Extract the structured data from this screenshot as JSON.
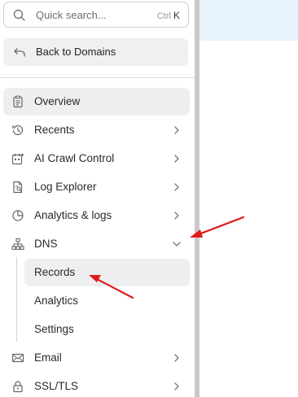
{
  "search": {
    "placeholder": "Quick search...",
    "shortcut_ctrl": "Ctrl",
    "shortcut_key": "K"
  },
  "back": {
    "label": "Back to Domains"
  },
  "nav": {
    "overview": "Overview",
    "recents": "Recents",
    "ai_crawl": "AI Crawl Control",
    "log_explorer": "Log Explorer",
    "analytics_logs": "Analytics & logs",
    "dns": "DNS",
    "email": "Email",
    "ssl": "SSL/TLS"
  },
  "dns_sub": {
    "records": "Records",
    "analytics": "Analytics",
    "settings": "Settings"
  },
  "colors": {
    "annotation_arrow": "#e01b1b",
    "active_bg": "#efefef",
    "main_banner": "#e8f3fb"
  }
}
